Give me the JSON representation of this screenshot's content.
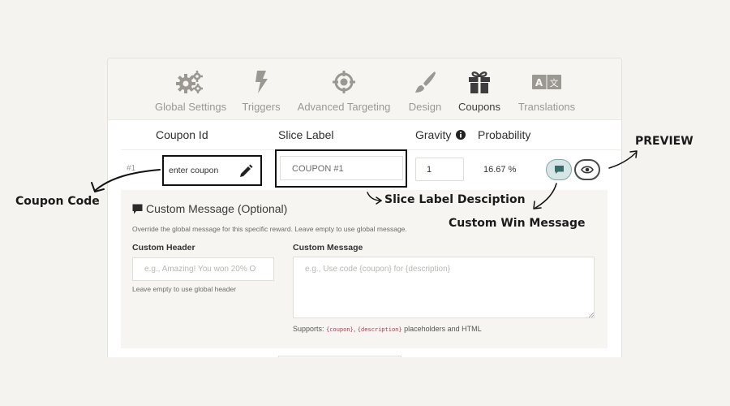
{
  "tabs": [
    {
      "label": "Global Settings",
      "icon": "gears-icon",
      "active": false
    },
    {
      "label": "Triggers",
      "icon": "lightning-icon",
      "active": false
    },
    {
      "label": "Advanced Targeting",
      "icon": "crosshair-icon",
      "active": false
    },
    {
      "label": "Design",
      "icon": "paintbrush-icon",
      "active": false
    },
    {
      "label": "Coupons",
      "icon": "gift-icon",
      "active": true
    },
    {
      "label": "Translations",
      "icon": "translate-icon",
      "active": false
    }
  ],
  "table": {
    "headers": {
      "coupon_id": "Coupon Id",
      "slice_label": "Slice Label",
      "gravity": "Gravity",
      "probability": "Probability"
    },
    "row": {
      "number": "#1",
      "coupon_value": "enter coupon",
      "slice_label_value": "COUPON #1",
      "gravity_value": "1",
      "probability_value": "16.67 %"
    }
  },
  "custom_message": {
    "title": "Custom Message (Optional)",
    "description": "Override the global message for this specific reward. Leave empty to use global message.",
    "header_label": "Custom Header",
    "header_placeholder": "e.g., Amazing! You won 20% O",
    "header_hint": "Leave empty to use global header",
    "message_label": "Custom Message",
    "message_placeholder": "e.g., Use code {coupon} for {description}",
    "supports_prefix": "Supports:",
    "placeholder_coupon": "{coupon}",
    "separator": ",",
    "placeholder_description": "{description}",
    "supports_suffix": "placeholders and HTML"
  },
  "annotations": {
    "preview": "PREVIEW",
    "coupon_code": "Coupon Code",
    "slice_label_desc": "Slice Label Desciption",
    "custom_win_message": "Custom Win Message"
  },
  "colors": {
    "background": "#f4f3ef",
    "icon_gray": "#9b9892",
    "icon_active": "#3d3d3d",
    "code_red": "#b8344c",
    "msg_button": "#d6e6e6"
  }
}
